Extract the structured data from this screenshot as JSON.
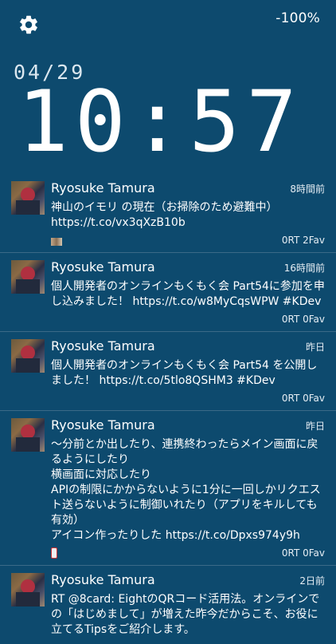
{
  "status": {
    "battery": "-100%"
  },
  "date": "04/29",
  "clock": "10:57",
  "tweets": [
    {
      "name": "Ryosuke Tamura",
      "time": "8時間前",
      "text": "神山のイモリ の現在（お掃除のため避難中） https://t.co/vx3qXzB10b",
      "counts": "0RT 2Fav",
      "media": "photo"
    },
    {
      "name": "Ryosuke Tamura",
      "time": "16時間前",
      "text": "個人開発者のオンラインもくもく会 Part54に参加を申し込みました！ https://t.co/w8MyCqsWPW #KDev",
      "counts": "0RT 0Fav",
      "media": ""
    },
    {
      "name": "Ryosuke Tamura",
      "time": "昨日",
      "text": "個人開発者のオンラインもくもく会 Part54 を公開しました！ https://t.co/5tlo8QSHM3 #KDev",
      "counts": "0RT 0Fav",
      "media": ""
    },
    {
      "name": "Ryosuke Tamura",
      "time": "昨日",
      "text": "〜分前とか出したり、連携終わったらメイン画面に戻るようにしたり\n横画面に対応したり\nAPIの制限にかからないように1分に一回しかリクエスト送らないように制御いれたり（アプリをキルしても有効）\nアイコン作ったりした https://t.co/Dpxs974y9h",
      "counts": "0RT 0Fav",
      "media": "phone"
    },
    {
      "name": "Ryosuke Tamura",
      "time": "2日前",
      "text": "RT @8card: EightのQRコード活用法。オンラインでの「はじめまして」が増えた昨今だからこそ、お役に立てるTipsをご紹介します。",
      "counts": "",
      "media": ""
    }
  ]
}
